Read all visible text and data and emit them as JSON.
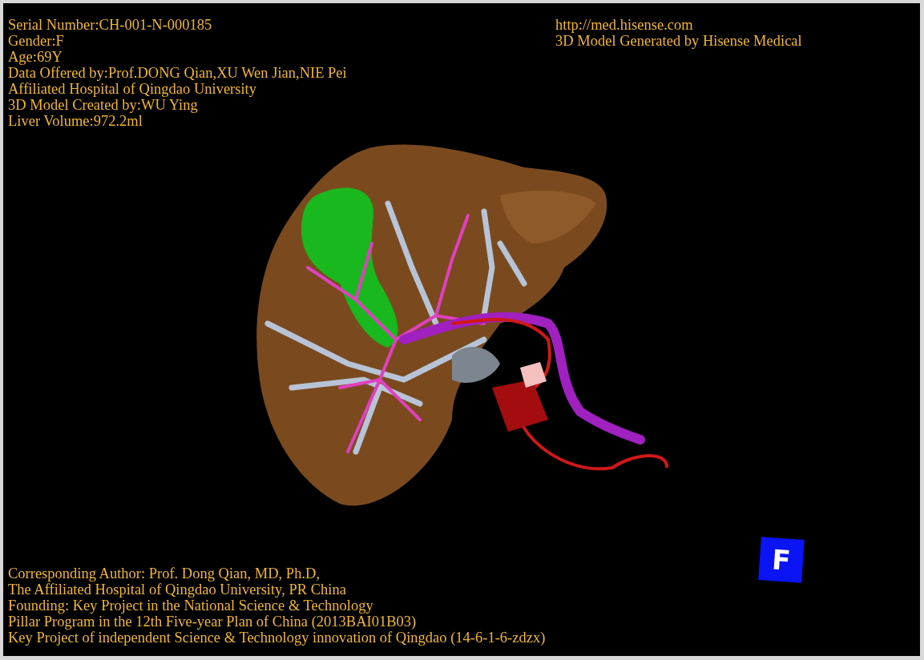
{
  "patient_info": [
    "Serial Number:CH-001-N-000185",
    "Gender:F",
    "Age:69Y",
    "Data Offered by:Prof.DONG Qian,XU Wen Jian,NIE Pei",
    "Affiliated Hospital of Qingdao University",
    "3D Model Created by:WU Ying",
    "Liver Volume:972.2ml"
  ],
  "vendor_info": [
    "http://med.hisense.com",
    "3D Model Generated by Hisense Medical"
  ],
  "credits": [
    "Corresponding Author: Prof. Dong Qian, MD, Ph.D,",
    "The Affiliated Hospital of Qingdao University, PR China",
    "Founding: Key Project in the National Science & Technology",
    "Pillar Program in the 12th Five-year Plan of China (2013BAI01B03)",
    "Key Project of independent Science & Technology innovation of Qingdao (14-6-1-6-zdzx)"
  ],
  "orientation_cube": {
    "label": "F"
  }
}
